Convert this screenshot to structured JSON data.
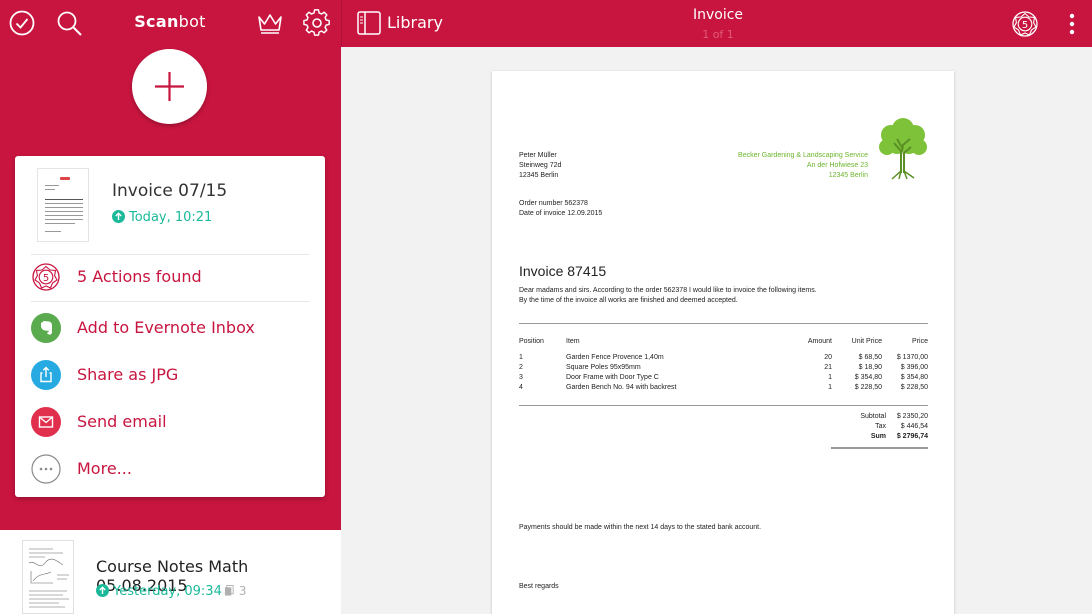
{
  "left_toolbar": {
    "app_name_bold": "Scan",
    "app_name_rest": "bot",
    "icons": [
      "checkmark-icon",
      "search-icon",
      "crown-icon",
      "gear-icon"
    ]
  },
  "card": {
    "doc_title": "Invoice 07/15",
    "doc_time": "Today, 10:21",
    "actions": [
      {
        "label": "5 Actions found",
        "icon": "actions-badge-icon",
        "badge": "5",
        "color": "#c8153f"
      },
      {
        "label": "Add to Evernote Inbox",
        "icon": "evernote-icon",
        "color": "#5aaa4e"
      },
      {
        "label": "Share as JPG",
        "icon": "share-icon",
        "color": "#27aae1"
      },
      {
        "label": "Send email",
        "icon": "mail-icon",
        "color": "#e0304d"
      },
      {
        "label": "More...",
        "icon": "more-icon",
        "color": "#8a8a8a"
      }
    ]
  },
  "list": {
    "items": [
      {
        "title": "Course Notes Math 05.08.2015",
        "time": "Yesterday, 09:34",
        "pages": "3"
      }
    ]
  },
  "right_toolbar": {
    "library_label": "Library",
    "title": "Invoice",
    "page_indicator": "1 of 1",
    "actions_badge": "5"
  },
  "invoice": {
    "sender": [
      "Peter Müller",
      "Steinweg 72d",
      "12345 Berlin"
    ],
    "company": [
      "Becker Gardening & Landscaping Service",
      "An der Hofwiese 23",
      "12345 Berlin"
    ],
    "order_number": "Order number 562378",
    "date": "Date of invoice 12.09.2015",
    "heading": "Invoice 87415",
    "intro_1": "Dear madams and sirs. According to the order 562378 I would like to invoice the following items.",
    "intro_2": "By the time of the invoice all works are finished and deemed accepted.",
    "headers": {
      "position": "Position",
      "item": "Item",
      "amount": "Amount",
      "unit_price": "Unit Price",
      "price": "Price"
    },
    "rows": [
      {
        "position": "1",
        "item": "Garden Fence Provence 1,40m",
        "amount": "20",
        "unit_price": "$ 68,50",
        "price": "$ 1370,00"
      },
      {
        "position": "2",
        "item": "Square Poles 95x95mm",
        "amount": "21",
        "unit_price": "$ 18,90",
        "price": "$ 396,00"
      },
      {
        "position": "3",
        "item": "Door Frame with Door Type C",
        "amount": "1",
        "unit_price": "$ 354,80",
        "price": "$ 354,80"
      },
      {
        "position": "4",
        "item": "Garden Bench No. 94 with backrest",
        "amount": "1",
        "unit_price": "$ 228,50",
        "price": "$ 228,50"
      }
    ],
    "subtotal_label": "Subtotal",
    "subtotal": "$ 2350,20",
    "tax_label": "Tax",
    "tax": "$ 446,54",
    "sum_label": "Sum",
    "sum": "$ 2796,74",
    "payment_note": "Payments should be made within the next 14 days to the stated bank account.",
    "closing": "Best regards"
  }
}
